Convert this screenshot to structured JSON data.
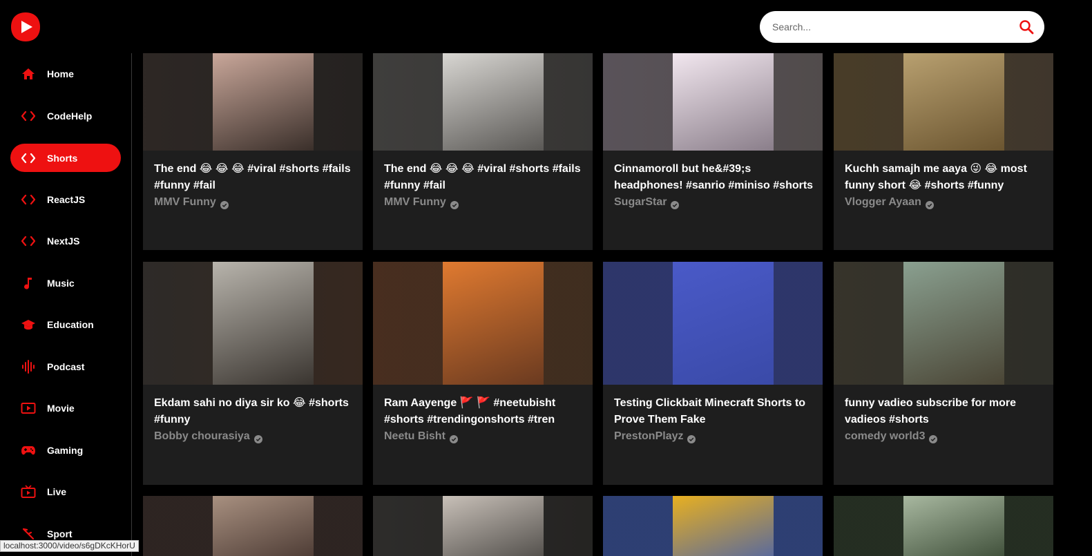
{
  "header": {
    "logo_icon": "youtube-play-icon",
    "search": {
      "placeholder": "Search...",
      "value": "",
      "icon": "search-icon"
    },
    "accent_color": "#ee1111"
  },
  "sidebar": {
    "items": [
      {
        "label": "Home",
        "icon": "home-icon",
        "active": false
      },
      {
        "label": "CodeHelp",
        "icon": "code-icon",
        "active": false
      },
      {
        "label": "Shorts",
        "icon": "code-icon",
        "active": true
      },
      {
        "label": "ReactJS",
        "icon": "code-icon",
        "active": false
      },
      {
        "label": "NextJS",
        "icon": "code-icon",
        "active": false
      },
      {
        "label": "Music",
        "icon": "music-note-icon",
        "active": false
      },
      {
        "label": "Education",
        "icon": "graduation-cap-icon",
        "active": false
      },
      {
        "label": "Podcast",
        "icon": "podcast-waveform-icon",
        "active": false
      },
      {
        "label": "Movie",
        "icon": "play-box-icon",
        "active": false
      },
      {
        "label": "Gaming",
        "icon": "gamepad-icon",
        "active": false
      },
      {
        "label": "Live",
        "icon": "live-tv-icon",
        "active": false
      },
      {
        "label": "Sport",
        "icon": "sport-icon",
        "active": false
      }
    ]
  },
  "videos": [
    {
      "title": "The end 😂 😂 😂 #viral #shorts #fails #funny #fail",
      "channel": "MMV Funny",
      "thumb_colors": [
        "#3a2f2a",
        "#c9a79a",
        "#2a2522"
      ]
    },
    {
      "title": "The end 😂 😂 😂 #viral #shorts #fails #funny #fail",
      "channel": "MMV Funny",
      "thumb_colors": [
        "#5a5855",
        "#d8d6d2",
        "#4a4845"
      ]
    },
    {
      "title": "Cinnamoroll but he&#39;s headphones! #sanrio #miniso #shorts",
      "channel": "SugarStar",
      "thumb_colors": [
        "#8a7e8a",
        "#f2e7ef",
        "#7a7070"
      ]
    },
    {
      "title": "Kuchh samajh me aaya 😜 😂 most funny short 😂 #shorts #funny",
      "channel": "Vlogger Ayaan",
      "thumb_colors": [
        "#6b5530",
        "#b8a070",
        "#5a4a38"
      ]
    },
    {
      "title": "Ekdam sahi no diya sir ko 😂 #shorts #funny",
      "channel": "Bobby chourasiya",
      "thumb_colors": [
        "#3a3530",
        "#b8b4ac",
        "#4a3020"
      ]
    },
    {
      "title": "Ram Aayenge 🚩 🚩 #neetubisht #shorts #trendingonshorts #tren",
      "channel": "Neetu Bisht",
      "thumb_colors": [
        "#6a3a20",
        "#e07a30",
        "#5a3a20"
      ]
    },
    {
      "title": "Testing Clickbait Minecraft Shorts to Prove Them Fake",
      "channel": "PrestonPlayz",
      "thumb_colors": [
        "#3a4aa8",
        "#4a5ac8",
        "#3a4aa8"
      ]
    },
    {
      "title": "funny vadieo subscribe for more vadieos #shorts",
      "channel": "comedy world3",
      "thumb_colors": [
        "#4a4535",
        "#8aa090",
        "#3a3a30"
      ]
    },
    {
      "title": "",
      "channel": "",
      "thumb_colors": [
        "#3a2a25",
        "#a89080",
        "#3a2a25"
      ]
    },
    {
      "title": "",
      "channel": "",
      "thumb_colors": [
        "#3a3835",
        "#c8c0b8",
        "#2a2825"
      ]
    },
    {
      "title": "",
      "channel": "",
      "thumb_colors": [
        "#3a5ab8",
        "#e8b020",
        "#3a5ab8"
      ]
    },
    {
      "title": "",
      "channel": "",
      "thumb_colors": [
        "#2a3a25",
        "#a8b8a0",
        "#2a3a25"
      ]
    }
  ],
  "status_bar": {
    "url": "localhost:3000/video/s6gDKcKHorU"
  }
}
